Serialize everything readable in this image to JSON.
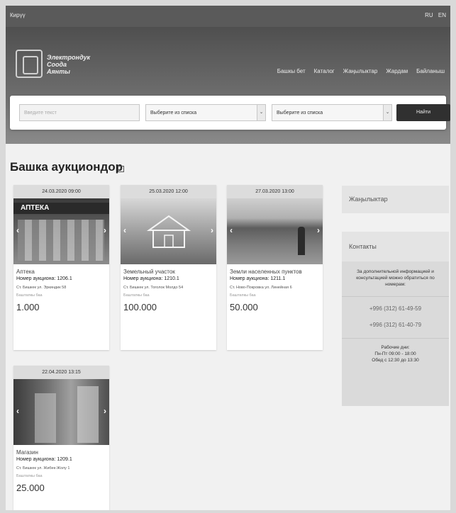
{
  "topbar": {
    "login": "Кирүү",
    "langs": [
      "RU",
      "EN"
    ]
  },
  "logo": {
    "line1": "Электрондук",
    "line2": "Соода",
    "line3": "Аянты"
  },
  "nav": [
    "Башкы бет",
    "Каталог",
    "Жаңылыктар",
    "Жардам",
    "Байланыш"
  ],
  "search": {
    "placeholder": "Введите текст",
    "select1": "Выберите из списка",
    "select2": "Выберите из списка",
    "button": "Найти"
  },
  "heading": "Башка аукциондор",
  "cards": [
    {
      "date": "24.03.2020 09:00",
      "title": "Аптека",
      "lot": "Номер аукциона: 1206.1",
      "addr": "Ст. Бишкек ул. Эркиндик 58",
      "start_label": "Баштапкы баа",
      "price": "1.000",
      "photo_text": "АПТЕКА"
    },
    {
      "date": "25.03.2020 12:00",
      "title": "Земельный участок",
      "lot": "Номер аукциона: 1210.1",
      "addr": "Ст. Бишкек ул. Тоголок Молдо 54",
      "start_label": "Баштапкы баа",
      "price": "100.000"
    },
    {
      "date": "27.03.2020 13:00",
      "title": "Земли населенных пунктов",
      "lot": "Номер аукциона: 1211.1",
      "addr": "Ст. Ново-Покровка ул. Линейная 6",
      "start_label": "Баштапкы баа",
      "price": "50.000"
    },
    {
      "date": "22.04.2020 13:15",
      "title": "Магазин",
      "lot": "Номер аукциона: 1209.1",
      "addr": "Ст. Бишкек ул. Жибек-Жолу 1",
      "start_label": "Баштапкы баа",
      "price": "25.000"
    }
  ],
  "sidebar": {
    "news_title": "Жаңылыктар",
    "contacts_title": "Контакты",
    "contacts_desc": "За дополнительной информацией и консультацией можно обратиться по номерам:",
    "phones": [
      "+996 (312) 61-49-59",
      "+996 (312) 61-40-79"
    ],
    "hours_title": "Рабочие дни:",
    "hours_days": "Пн-Пт 09:00 - 18:00",
    "hours_lunch": "Обед с 12:30 до 13:30"
  }
}
